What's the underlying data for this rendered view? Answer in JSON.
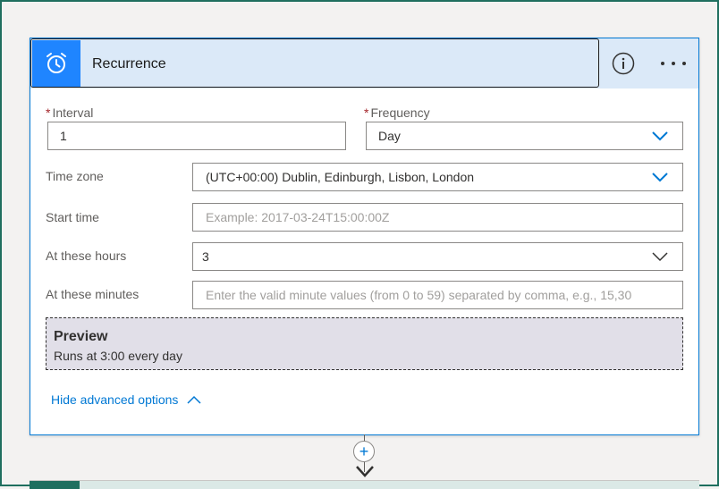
{
  "card": {
    "title": "Recurrence",
    "icon": "alarm-clock-icon",
    "accent_color": "#1f85ff"
  },
  "fields": {
    "interval": {
      "label": "Interval",
      "required_mark": "*",
      "value": "1"
    },
    "frequency": {
      "label": "Frequency",
      "required_mark": "*",
      "value": "Day"
    },
    "time_zone": {
      "label": "Time zone",
      "value": "(UTC+00:00) Dublin, Edinburgh, Lisbon, London"
    },
    "start_time": {
      "label": "Start time",
      "placeholder": "Example: 2017-03-24T15:00:00Z"
    },
    "at_these_hours": {
      "label": "At these hours",
      "value": "3"
    },
    "at_these_minutes": {
      "label": "At these minutes",
      "placeholder": "Enter the valid minute values (from 0 to 59) separated by comma, e.g., 15,30"
    }
  },
  "preview": {
    "title": "Preview",
    "text": "Runs at 3:00 every day"
  },
  "advanced": {
    "label": "Hide advanced options"
  },
  "actions": {
    "info": "info-icon",
    "more": "more-options-icon",
    "add": "+"
  }
}
